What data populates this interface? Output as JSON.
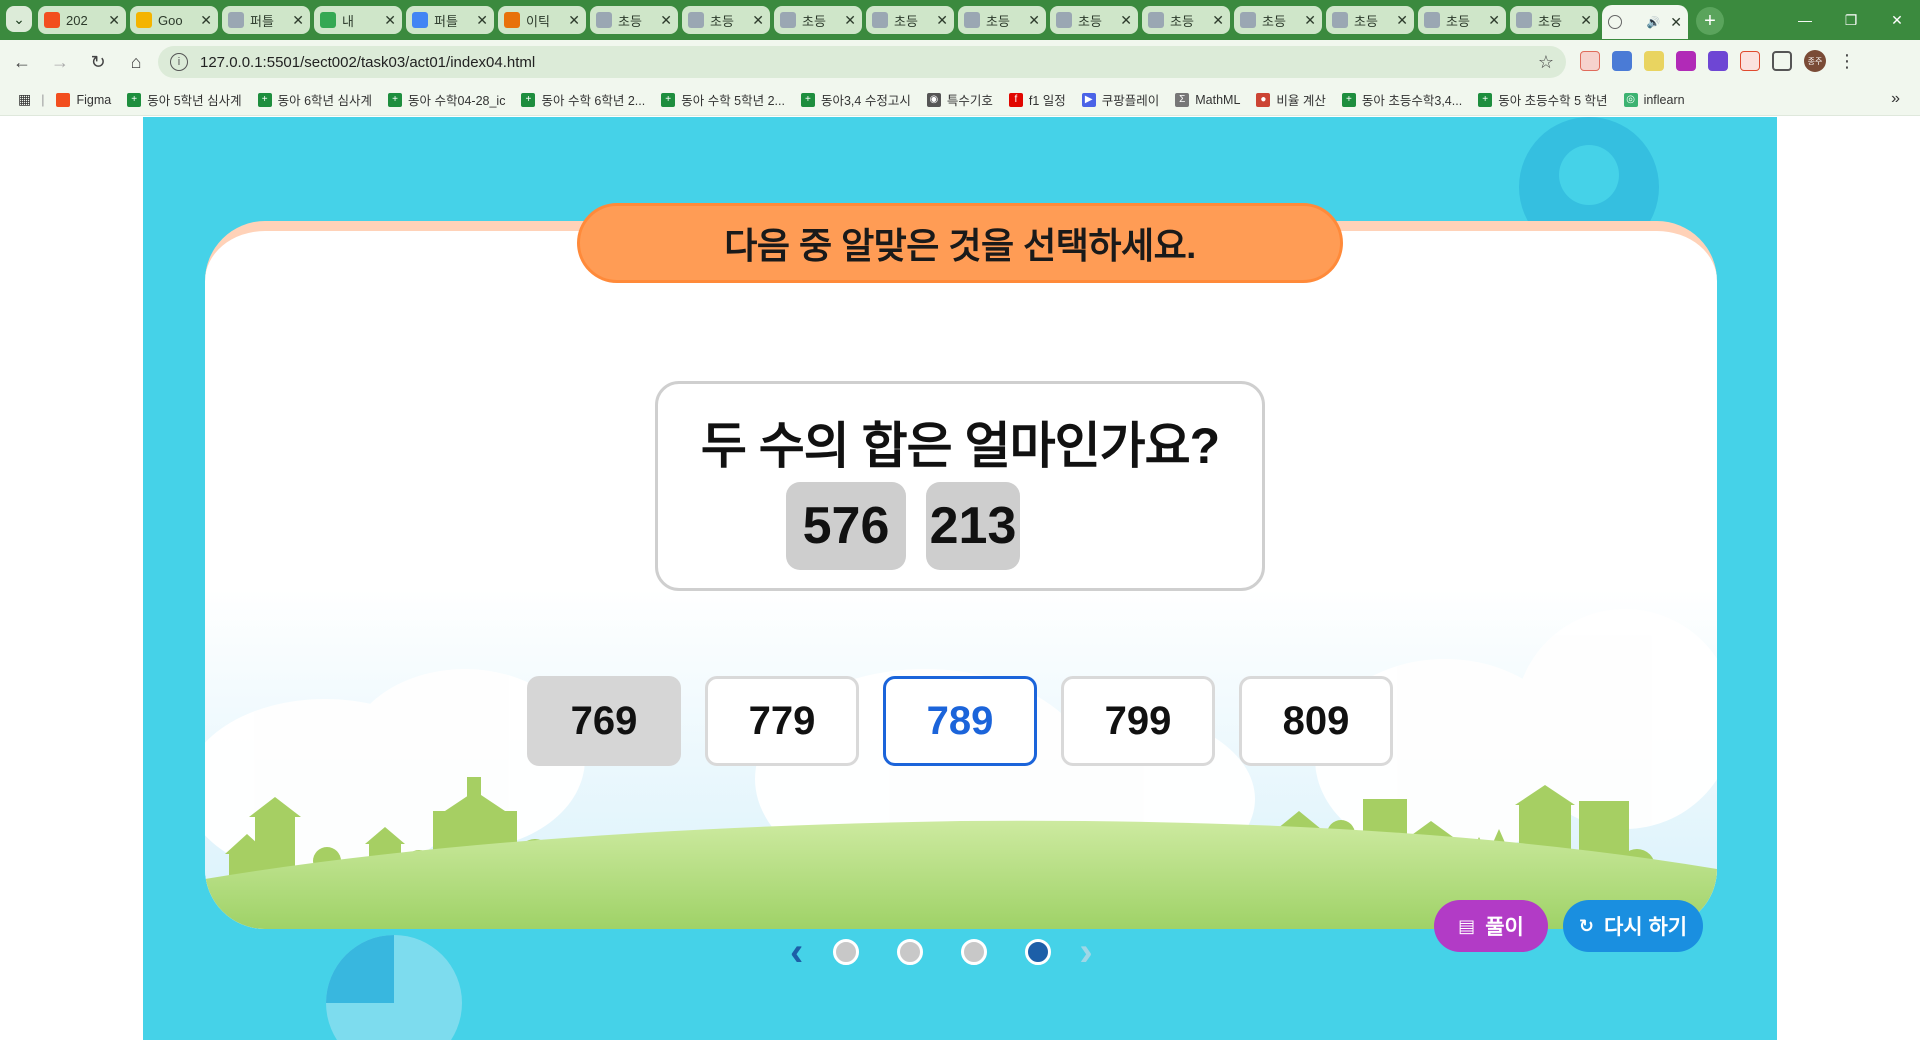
{
  "browser": {
    "tabs": [
      {
        "title": "202",
        "color": "#f24e1e"
      },
      {
        "title": "Goo",
        "color": "#f4b400"
      },
      {
        "title": "퍼틀",
        "color": "#9aa7b3"
      },
      {
        "title": "내 ",
        "color": "#34a853"
      },
      {
        "title": "퍼틀",
        "color": "#4285f4"
      },
      {
        "title": "이틱",
        "color": "#e8710a"
      },
      {
        "title": "초등",
        "color": "#9aa7b3"
      },
      {
        "title": "초등",
        "color": "#9aa7b3"
      },
      {
        "title": "초등",
        "color": "#9aa7b3"
      },
      {
        "title": "초등",
        "color": "#9aa7b3"
      },
      {
        "title": "초등",
        "color": "#9aa7b3"
      },
      {
        "title": "초등",
        "color": "#9aa7b3"
      },
      {
        "title": "초등",
        "color": "#9aa7b3"
      },
      {
        "title": "초등",
        "color": "#9aa7b3"
      },
      {
        "title": "초등",
        "color": "#9aa7b3"
      },
      {
        "title": "초등",
        "color": "#9aa7b3"
      },
      {
        "title": "초등",
        "color": "#9aa7b3"
      }
    ],
    "active_tab": {
      "title": ""
    },
    "url": "127.0.0.1:5501/sect002/task03/act01/index04.html",
    "avatar_text": "종주",
    "bookmarks": [
      {
        "label": "Figma",
        "type": "figma"
      },
      {
        "label": "동아 5학년 심사계",
        "type": "sheet"
      },
      {
        "label": "동아 6학년 심사계",
        "type": "sheet"
      },
      {
        "label": "동아 수학04-28_ic",
        "type": "sheet"
      },
      {
        "label": "동아 수학 6학년 2...",
        "type": "sheet"
      },
      {
        "label": "동아 수학 5학년 2...",
        "type": "sheet"
      },
      {
        "label": "동아3,4 수정고시",
        "type": "sheet"
      },
      {
        "label": "특수기호",
        "type": "globe"
      },
      {
        "label": "f1 일정",
        "type": "f1"
      },
      {
        "label": "쿠팡플레이",
        "type": "play"
      },
      {
        "label": "MathML",
        "type": "math"
      },
      {
        "label": "비율 계산",
        "type": "calc"
      },
      {
        "label": "동아 초등수학3,4...",
        "type": "sheet"
      },
      {
        "label": "동아 초등수학 5 학년",
        "type": "sheet"
      },
      {
        "label": "inflearn",
        "type": "inflearn"
      }
    ]
  },
  "activity": {
    "instruction": "다음 중 알맞은 것을 선택하세요.",
    "question": "두 수의 합은 얼마인가요?",
    "numbers": [
      "576",
      "213"
    ],
    "choices": [
      {
        "label": "769",
        "state": "disabled"
      },
      {
        "label": "779",
        "state": "normal"
      },
      {
        "label": "789",
        "state": "selected"
      },
      {
        "label": "799",
        "state": "normal"
      },
      {
        "label": "809",
        "state": "normal"
      }
    ],
    "pager": {
      "total": 4,
      "current": 4
    },
    "buttons": {
      "solution": "풀이",
      "retry": "다시 하기"
    },
    "colors": {
      "accent_selected": "#1b64da",
      "instruction_bg": "#ff9c55",
      "stage_bg": "#45d2e8"
    }
  }
}
